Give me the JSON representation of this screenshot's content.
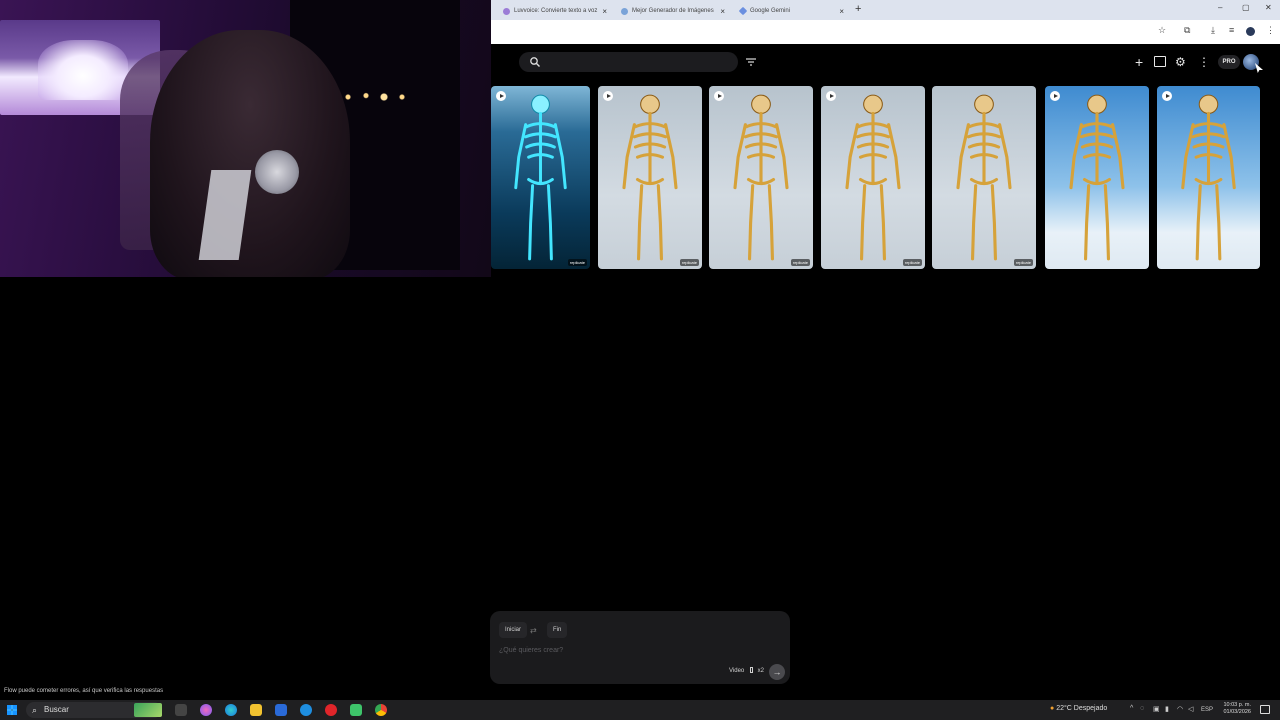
{
  "browser": {
    "tabs": [
      {
        "label": "Luvvoice: Convierte texto a voz",
        "icon_color": "#9b7cd6"
      },
      {
        "label": "Mejor Generador de Imágenes",
        "icon_color": "#7aa3d8"
      },
      {
        "label": "Google Gemini",
        "icon_color": "#6a8fe0"
      }
    ],
    "new_tab": "+",
    "close_glyph": "×",
    "window_controls": [
      "–",
      "▢",
      "✕"
    ]
  },
  "app": {
    "search": {
      "placeholder": ""
    },
    "toolbar_icons": [
      "add-icon",
      "panel-icon",
      "settings-icon",
      "more-icon"
    ],
    "plan_badge": "PRO",
    "gallery": [
      {
        "kind": "ocean",
        "play": true,
        "watermark": "replicate"
      },
      {
        "kind": "grey",
        "play": true,
        "watermark": "replicate"
      },
      {
        "kind": "grey",
        "play": true,
        "watermark": "replicate"
      },
      {
        "kind": "grey",
        "play": true,
        "watermark": "replicate"
      },
      {
        "kind": "grey",
        "play": false,
        "watermark": "replicate"
      },
      {
        "kind": "blue",
        "play": true,
        "watermark": ""
      },
      {
        "kind": "blue",
        "play": true,
        "watermark": ""
      }
    ]
  },
  "composer": {
    "start_label": "Iniciar",
    "end_label": "Fin",
    "placeholder": "¿Qué quieres crear?",
    "mode_label": "Video",
    "count_label": "x2",
    "send_glyph": "→"
  },
  "disclaimer": "Flow puede cometer errores, así que verifica las respuestas",
  "taskbar": {
    "search_label": "Buscar",
    "weather": "22°C  Despejado",
    "language": "ESP",
    "time": "10:03 p. m.",
    "date": "01/03/2026"
  }
}
